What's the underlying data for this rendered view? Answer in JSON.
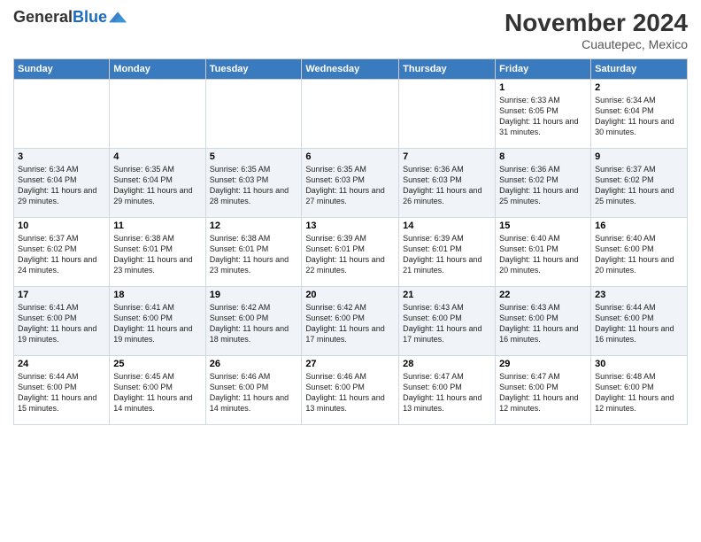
{
  "logo": {
    "general": "General",
    "blue": "Blue"
  },
  "header": {
    "title": "November 2024",
    "location": "Cuautepec, Mexico"
  },
  "days_of_week": [
    "Sunday",
    "Monday",
    "Tuesday",
    "Wednesday",
    "Thursday",
    "Friday",
    "Saturday"
  ],
  "weeks": [
    [
      {
        "day": "",
        "info": ""
      },
      {
        "day": "",
        "info": ""
      },
      {
        "day": "",
        "info": ""
      },
      {
        "day": "",
        "info": ""
      },
      {
        "day": "",
        "info": ""
      },
      {
        "day": "1",
        "info": "Sunrise: 6:33 AM\nSunset: 6:05 PM\nDaylight: 11 hours and 31 minutes."
      },
      {
        "day": "2",
        "info": "Sunrise: 6:34 AM\nSunset: 6:04 PM\nDaylight: 11 hours and 30 minutes."
      }
    ],
    [
      {
        "day": "3",
        "info": "Sunrise: 6:34 AM\nSunset: 6:04 PM\nDaylight: 11 hours and 29 minutes."
      },
      {
        "day": "4",
        "info": "Sunrise: 6:35 AM\nSunset: 6:04 PM\nDaylight: 11 hours and 29 minutes."
      },
      {
        "day": "5",
        "info": "Sunrise: 6:35 AM\nSunset: 6:03 PM\nDaylight: 11 hours and 28 minutes."
      },
      {
        "day": "6",
        "info": "Sunrise: 6:35 AM\nSunset: 6:03 PM\nDaylight: 11 hours and 27 minutes."
      },
      {
        "day": "7",
        "info": "Sunrise: 6:36 AM\nSunset: 6:03 PM\nDaylight: 11 hours and 26 minutes."
      },
      {
        "day": "8",
        "info": "Sunrise: 6:36 AM\nSunset: 6:02 PM\nDaylight: 11 hours and 25 minutes."
      },
      {
        "day": "9",
        "info": "Sunrise: 6:37 AM\nSunset: 6:02 PM\nDaylight: 11 hours and 25 minutes."
      }
    ],
    [
      {
        "day": "10",
        "info": "Sunrise: 6:37 AM\nSunset: 6:02 PM\nDaylight: 11 hours and 24 minutes."
      },
      {
        "day": "11",
        "info": "Sunrise: 6:38 AM\nSunset: 6:01 PM\nDaylight: 11 hours and 23 minutes."
      },
      {
        "day": "12",
        "info": "Sunrise: 6:38 AM\nSunset: 6:01 PM\nDaylight: 11 hours and 23 minutes."
      },
      {
        "day": "13",
        "info": "Sunrise: 6:39 AM\nSunset: 6:01 PM\nDaylight: 11 hours and 22 minutes."
      },
      {
        "day": "14",
        "info": "Sunrise: 6:39 AM\nSunset: 6:01 PM\nDaylight: 11 hours and 21 minutes."
      },
      {
        "day": "15",
        "info": "Sunrise: 6:40 AM\nSunset: 6:01 PM\nDaylight: 11 hours and 20 minutes."
      },
      {
        "day": "16",
        "info": "Sunrise: 6:40 AM\nSunset: 6:00 PM\nDaylight: 11 hours and 20 minutes."
      }
    ],
    [
      {
        "day": "17",
        "info": "Sunrise: 6:41 AM\nSunset: 6:00 PM\nDaylight: 11 hours and 19 minutes."
      },
      {
        "day": "18",
        "info": "Sunrise: 6:41 AM\nSunset: 6:00 PM\nDaylight: 11 hours and 19 minutes."
      },
      {
        "day": "19",
        "info": "Sunrise: 6:42 AM\nSunset: 6:00 PM\nDaylight: 11 hours and 18 minutes."
      },
      {
        "day": "20",
        "info": "Sunrise: 6:42 AM\nSunset: 6:00 PM\nDaylight: 11 hours and 17 minutes."
      },
      {
        "day": "21",
        "info": "Sunrise: 6:43 AM\nSunset: 6:00 PM\nDaylight: 11 hours and 17 minutes."
      },
      {
        "day": "22",
        "info": "Sunrise: 6:43 AM\nSunset: 6:00 PM\nDaylight: 11 hours and 16 minutes."
      },
      {
        "day": "23",
        "info": "Sunrise: 6:44 AM\nSunset: 6:00 PM\nDaylight: 11 hours and 16 minutes."
      }
    ],
    [
      {
        "day": "24",
        "info": "Sunrise: 6:44 AM\nSunset: 6:00 PM\nDaylight: 11 hours and 15 minutes."
      },
      {
        "day": "25",
        "info": "Sunrise: 6:45 AM\nSunset: 6:00 PM\nDaylight: 11 hours and 14 minutes."
      },
      {
        "day": "26",
        "info": "Sunrise: 6:46 AM\nSunset: 6:00 PM\nDaylight: 11 hours and 14 minutes."
      },
      {
        "day": "27",
        "info": "Sunrise: 6:46 AM\nSunset: 6:00 PM\nDaylight: 11 hours and 13 minutes."
      },
      {
        "day": "28",
        "info": "Sunrise: 6:47 AM\nSunset: 6:00 PM\nDaylight: 11 hours and 13 minutes."
      },
      {
        "day": "29",
        "info": "Sunrise: 6:47 AM\nSunset: 6:00 PM\nDaylight: 11 hours and 12 minutes."
      },
      {
        "day": "30",
        "info": "Sunrise: 6:48 AM\nSunset: 6:00 PM\nDaylight: 11 hours and 12 minutes."
      }
    ]
  ]
}
